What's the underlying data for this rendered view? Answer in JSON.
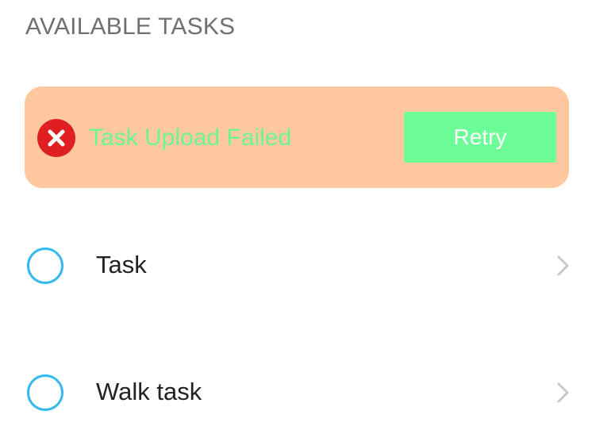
{
  "section": {
    "title": "AVAILABLE TASKS"
  },
  "banner": {
    "icon": "error-x-icon",
    "message": "Task Upload Failed",
    "retry_label": "Retry",
    "colors": {
      "background": "#ffc89e",
      "message_text": "#6cf594",
      "button_background": "#6cfd96",
      "error_icon": "#e02020"
    }
  },
  "tasks": [
    {
      "label": "Task",
      "icon": "radio-circle-icon",
      "trailing_icon": "chevron-right-icon"
    },
    {
      "label": "Walk task",
      "icon": "radio-circle-icon",
      "trailing_icon": "chevron-right-icon"
    }
  ],
  "colors": {
    "radio_circle": "#35b9f0",
    "chevron": "#c8c8c8"
  }
}
